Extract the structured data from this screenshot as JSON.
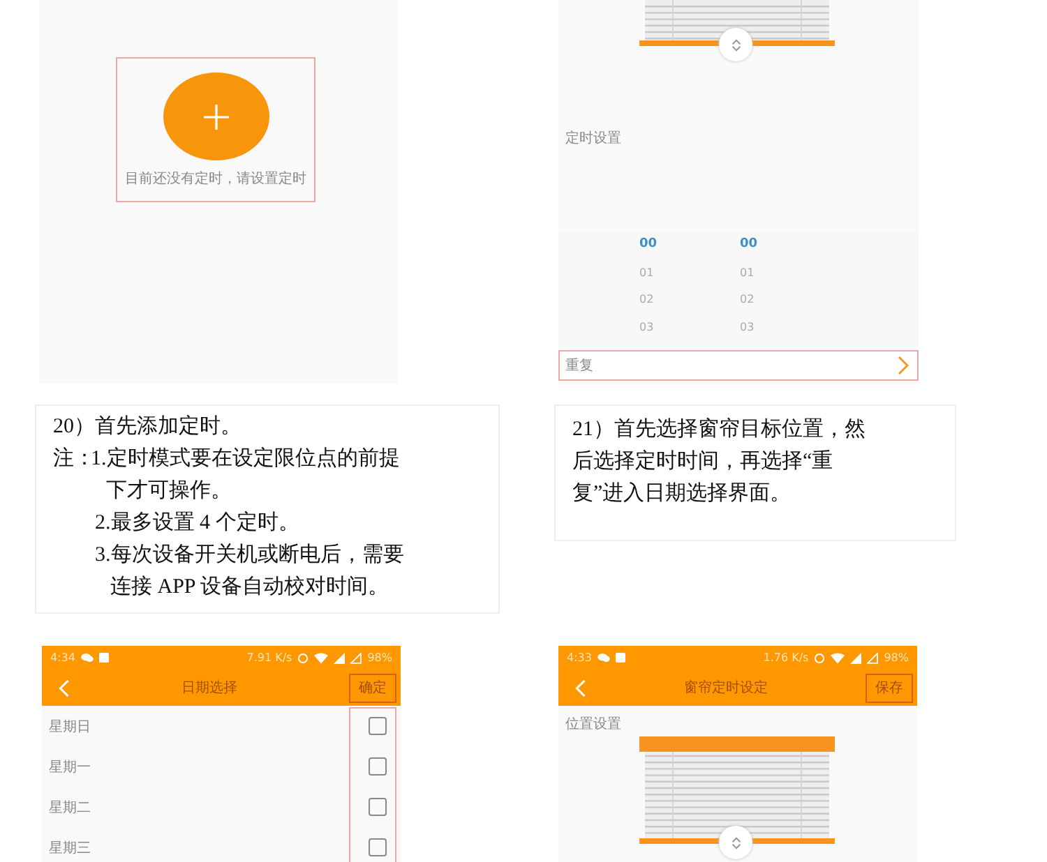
{
  "columns": [
    {
      "top_screen": {
        "kind": "empty_timer",
        "message": "目前还没有定时，请设置定时"
      },
      "caption": {
        "kind": "notes",
        "title": "20）首先添加定时。",
        "note_label": "注：",
        "notes": [
          "1.定时模式要在设定限位点的前提下才可操作。",
          "2.最多设置 4 个定时。",
          "3.每次设备开关机或断电后，需要连接 APP 设备自动校对时间。"
        ]
      },
      "bottom_screen": {
        "kind": "day_picker",
        "status_time": "4:34",
        "status_speed": "7.91 K/s",
        "status_battery": "98%",
        "title": "日期选择",
        "action": "确定",
        "days": [
          {
            "label": "星期日",
            "checked": false
          },
          {
            "label": "星期一",
            "checked": false
          },
          {
            "label": "星期二",
            "checked": false
          },
          {
            "label": "星期三",
            "checked": false
          }
        ]
      }
    },
    {
      "top_screen": {
        "kind": "timer_setting",
        "section_label": "定时设置",
        "hours": [
          {
            "text": "00",
            "selected": true
          },
          {
            "text": "01",
            "selected": false
          },
          {
            "text": "02",
            "selected": false
          },
          {
            "text": "03",
            "selected": false
          }
        ],
        "minutes": [
          {
            "text": "00",
            "selected": true
          },
          {
            "text": "01",
            "selected": false
          },
          {
            "text": "02",
            "selected": false
          },
          {
            "text": "03",
            "selected": false
          }
        ],
        "repeat_label": "重复"
      },
      "caption": {
        "kind": "paragraph",
        "text": "21）首先选择窗帘目标位置，然后选择定时时间，再选择“重复”进入日期选择界面。"
      },
      "bottom_screen": {
        "kind": "curtain_timer",
        "status_time": "4:33",
        "status_speed": "1.76 K/s",
        "status_battery": "98%",
        "title": "窗帘定时设定",
        "action": "保存",
        "section_label": "位置设置"
      }
    }
  ]
}
